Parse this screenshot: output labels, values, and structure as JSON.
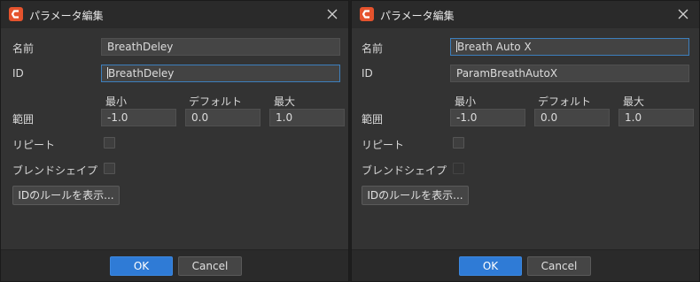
{
  "dialogs": [
    {
      "title": "パラメータ編集",
      "labels": {
        "name": "名前",
        "id": "ID",
        "range": "範囲",
        "repeat": "リピート",
        "blend_shape": "ブレンドシェイプ"
      },
      "range_headers": {
        "min": "最小",
        "default": "デフォルト",
        "max": "最大"
      },
      "fields": {
        "name_value": "BreathDeley",
        "id_value": "BreathDeley",
        "min_value": "-1.0",
        "default_value": "0.0",
        "max_value": "1.0"
      },
      "focused_field": "id",
      "repeat_checked": false,
      "blend_shape_checked": false,
      "rules_button": "IDのルールを表示...",
      "ok_button": "OK",
      "cancel_button": "Cancel"
    },
    {
      "title": "パラメータ編集",
      "labels": {
        "name": "名前",
        "id": "ID",
        "range": "範囲",
        "repeat": "リピート",
        "blend_shape": "ブレンドシェイプ"
      },
      "range_headers": {
        "min": "最小",
        "default": "デフォルト",
        "max": "最大"
      },
      "fields": {
        "name_value": "Breath Auto X",
        "id_value": "ParamBreathAutoX",
        "min_value": "-1.0",
        "default_value": "0.0",
        "max_value": "1.0"
      },
      "focused_field": "name",
      "repeat_checked": false,
      "blend_shape_checked": false,
      "blend_shape_disabled": true,
      "rules_button": "IDのルールを表示...",
      "ok_button": "OK",
      "cancel_button": "Cancel"
    }
  ],
  "icons": {
    "app": "cubism-logo-icon",
    "close": "close-icon"
  },
  "colors": {
    "accent": "#2f7bd6",
    "focus_border": "#3d7fbd",
    "logo": "#e5532d"
  }
}
